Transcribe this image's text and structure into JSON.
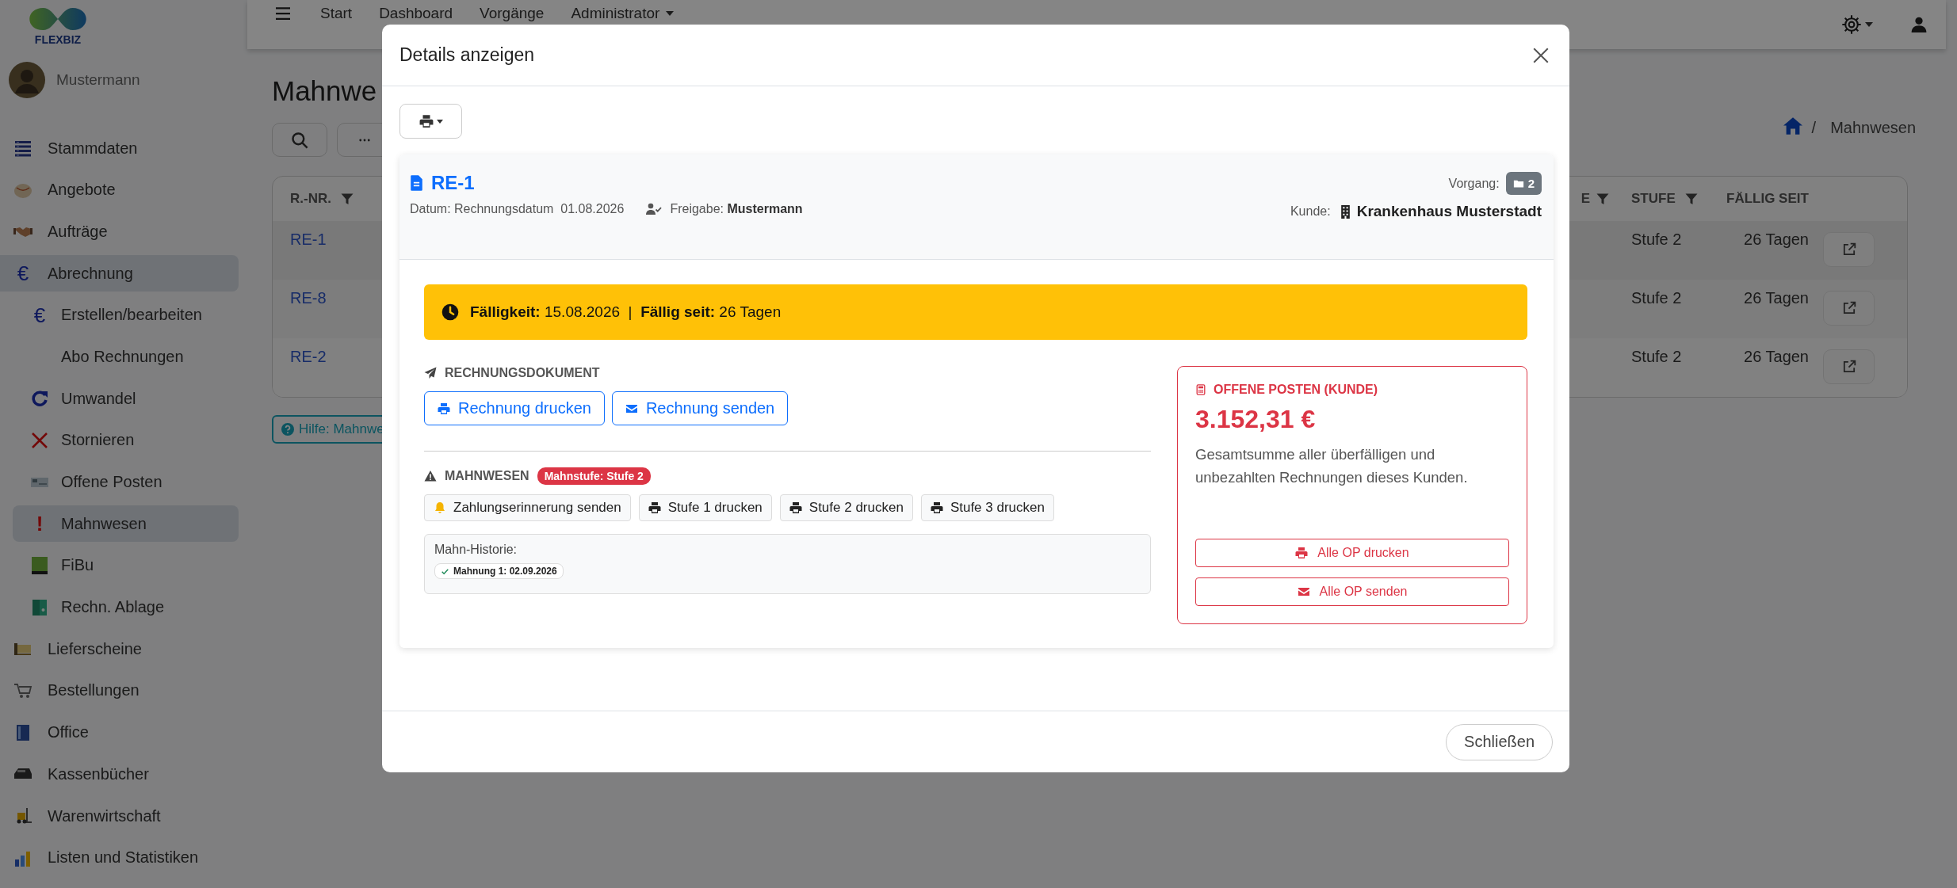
{
  "app": {
    "logo_text": "FLEXBIZ",
    "user_name": "Mustermann"
  },
  "sidebar": {
    "items": [
      {
        "label": "Stammdaten",
        "selected": false
      },
      {
        "label": "Angebote",
        "selected": false
      },
      {
        "label": "Aufträge",
        "selected": false
      },
      {
        "label": "Abrechnung",
        "selected": true,
        "glyph": "€",
        "children": [
          {
            "label": "Erstellen/bearbeiten",
            "selected": false,
            "glyph": "€"
          },
          {
            "label": "Abo Rechnungen",
            "selected": false
          },
          {
            "label": "Umwandel",
            "selected": false
          },
          {
            "label": "Stornieren",
            "selected": false
          },
          {
            "label": "Offene Posten",
            "selected": false
          },
          {
            "label": "Mahnwesen",
            "selected": true,
            "glyph": "!"
          },
          {
            "label": "FiBu",
            "selected": false
          },
          {
            "label": "Rechn. Ablage",
            "selected": false
          }
        ]
      },
      {
        "label": "Lieferscheine",
        "selected": false
      },
      {
        "label": "Bestellungen",
        "selected": false
      },
      {
        "label": "Office",
        "selected": false
      },
      {
        "label": "Kassenbücher",
        "selected": false
      },
      {
        "label": "Warenwirtschaft",
        "selected": false
      },
      {
        "label": "Listen und Statistiken",
        "selected": false
      }
    ]
  },
  "topbar": {
    "items": [
      {
        "label": "Start",
        "dropdown": false
      },
      {
        "label": "Dashboard",
        "dropdown": false
      },
      {
        "label": "Vorgänge",
        "dropdown": false
      },
      {
        "label": "Administrator",
        "dropdown": true
      }
    ]
  },
  "page": {
    "title": "Mahnwe",
    "breadcrumb": {
      "separator": "/",
      "items": [
        "Mahnwesen"
      ]
    },
    "table": {
      "columns": [
        {
          "label": "R.-NR.",
          "filter": true
        },
        {
          "label": "E",
          "filter": true
        },
        {
          "label": "STUFE",
          "filter": true
        },
        {
          "label": "FÄLLIG SEIT",
          "filter": false
        }
      ],
      "rows": [
        {
          "number": "RE-1",
          "stufe": "Stufe 2",
          "faellig_seit": "26 Tagen"
        },
        {
          "number": "RE-8",
          "stufe": "Stufe 2",
          "faellig_seit": "26 Tagen"
        },
        {
          "number": "RE-2",
          "stufe": "Stufe 2",
          "faellig_seit": "26 Tagen"
        }
      ]
    },
    "help_button": "Hilfe: Mahnwe"
  },
  "modal": {
    "title": "Details anzeigen",
    "invoice": {
      "number": "RE-1",
      "date": "Datum: Rechnungsdatum  01.08.2026",
      "approval": "Freigabe: **Mustermann**",
      "vorgang_label": "Vorgang:",
      "vorgang_count": "2",
      "customer_label": "Kunde:",
      "customer": "Krankenhaus Musterstadt"
    },
    "alert": "**Fälligkeit:** 15.08.2026  |  **Fällig seit:** 26 Tagen",
    "document": {
      "title": "RECHNUNGSDOKUMENT",
      "buttons": [
        {
          "label": "Rechnung drucken",
          "kind": "print"
        },
        {
          "label": "Rechnung senden",
          "kind": "mail"
        }
      ]
    },
    "dunning": {
      "title": "MAHNWESEN",
      "level_badge": "Mahnstufe: Stufe 2",
      "buttons": [
        {
          "label": "Zahlungserinnerung senden",
          "kind": "reminder"
        },
        {
          "label": "Stufe 1 drucken",
          "kind": "print"
        },
        {
          "label": "Stufe 2 drucken",
          "kind": "print"
        },
        {
          "label": "Stufe 3 drucken",
          "kind": "print"
        }
      ],
      "history": {
        "title": "Mahn-Historie:",
        "entries": [
          "Mahnung 1: 02.09.2026"
        ]
      }
    },
    "open_items": {
      "title": "OFFENE POSTEN (KUNDE)",
      "amount": "3.152,31 €",
      "description": "Gesamtsumme aller überfälligen und unbezahlten Rechnungen dieses Kunden.",
      "buttons": [
        {
          "label": "Alle OP drucken",
          "kind": "print"
        },
        {
          "label": "Alle OP senden",
          "kind": "mail"
        }
      ]
    },
    "close_button": "Schließen"
  }
}
